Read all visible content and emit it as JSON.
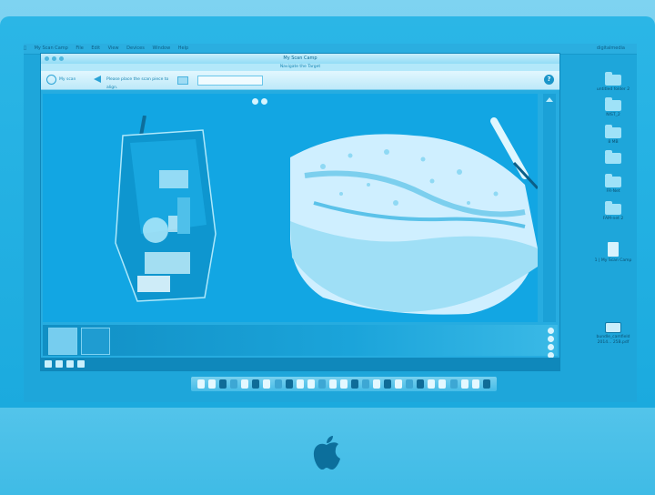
{
  "menubar": {
    "app_name": "My Scan Camp",
    "items": [
      "File",
      "Edit",
      "View",
      "Devices",
      "Window",
      "Help"
    ],
    "right_text": "digitalmedia"
  },
  "window": {
    "title": "My Scan Camp",
    "subtitle": "Navigate the Target",
    "toolbar": {
      "logo_text": "My scan",
      "instruction": "Please place the scan piece to align.",
      "search_placeholder": "",
      "help_label": "?"
    }
  },
  "desktop": {
    "icons": [
      {
        "label": "untitled folder 2",
        "kind": "folder"
      },
      {
        "label": "NIST_2",
        "kind": "folder"
      },
      {
        "label": "8 MB",
        "kind": "folder"
      },
      {
        "label": "",
        "kind": "folder"
      },
      {
        "label": "FR-Net",
        "kind": "folder"
      },
      {
        "label": "FAM-net 2",
        "kind": "folder"
      },
      {
        "label": "1 | My Scan Camp",
        "kind": "doc"
      },
      {
        "label": "bundle_camfield 2014... 25B.pdf",
        "kind": "hdd"
      }
    ]
  },
  "colors": {
    "tint": "#1ea6da",
    "frame": "#18a8dd",
    "chin": "#3fbbe6"
  }
}
